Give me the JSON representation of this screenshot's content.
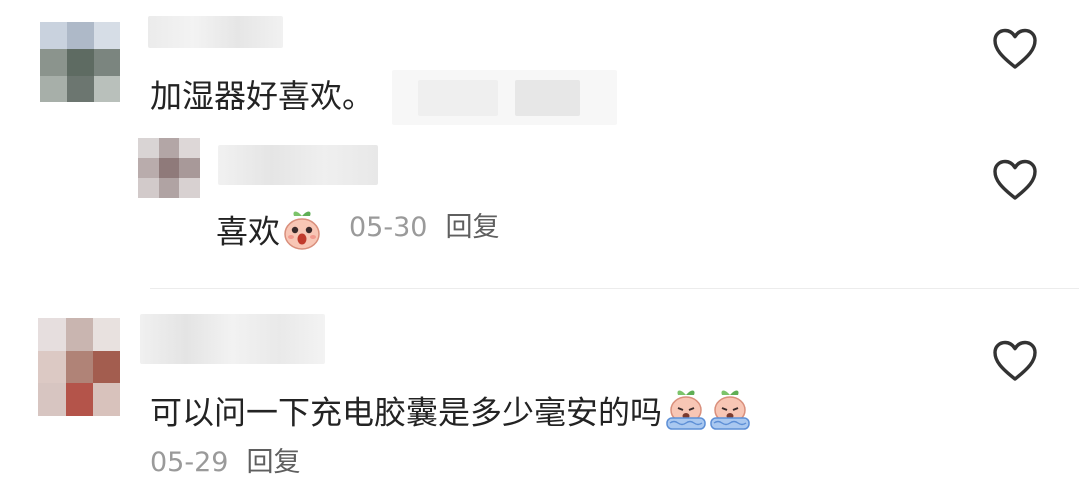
{
  "comments": [
    {
      "text": "加湿器好喜欢。",
      "like_icon": "heart-outline-icon",
      "reply": {
        "text": "喜欢",
        "emoji": "peach-shocked-emoji",
        "date": "05-30",
        "reply_label": "回复",
        "like_icon": "heart-outline-icon"
      }
    },
    {
      "text": "可以问一下充电胶囊是多少毫安的吗",
      "emojis": [
        "peach-crying-emoji",
        "peach-crying-emoji"
      ],
      "date": "05-29",
      "reply_label": "回复",
      "like_icon": "heart-outline-icon"
    }
  ],
  "colors": {
    "text": "#232323",
    "date": "#9a9a9a",
    "reply": "#5f5f5f",
    "divider": "#ececec",
    "heart": "#333333"
  }
}
